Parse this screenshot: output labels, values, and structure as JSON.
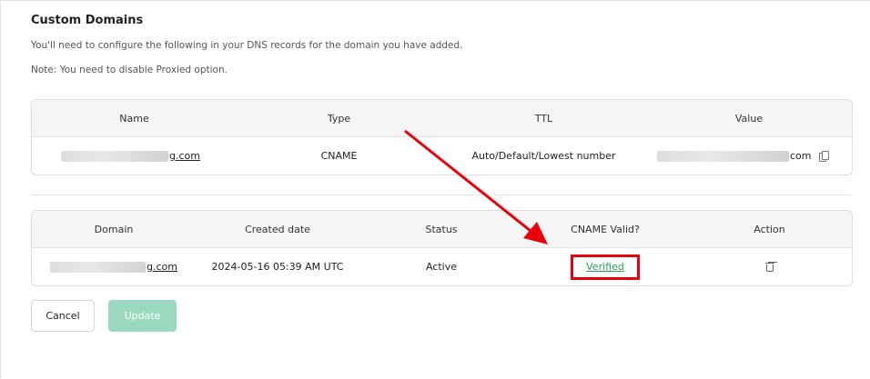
{
  "section_title": "Custom Domains",
  "instructions": [
    "You'll need to configure the following in your DNS records for the domain you have added.",
    "Note: You need to disable Proxied option."
  ],
  "dns_table": {
    "headers": [
      "Name",
      "Type",
      "TTL",
      "Value"
    ],
    "row": {
      "name_suffix": "g.com",
      "type": "CNAME",
      "ttl": "Auto/Default/Lowest number",
      "value_suffix": "com",
      "copy_icon": "copy-icon"
    }
  },
  "domains_table": {
    "headers": [
      "Domain",
      "Created date",
      "Status",
      "CNAME Valid?",
      "Action"
    ],
    "row": {
      "domain_suffix": "g.com",
      "created": "2024-05-16 05:39 AM UTC",
      "status": "Active",
      "cname_valid": "Verified",
      "action_icon": "trash-icon"
    }
  },
  "buttons": {
    "cancel": "Cancel",
    "update": "Update"
  },
  "colors": {
    "verified": "#27a35a",
    "annotation": "#e8000a",
    "update_disabled": "#9ad9c0"
  }
}
